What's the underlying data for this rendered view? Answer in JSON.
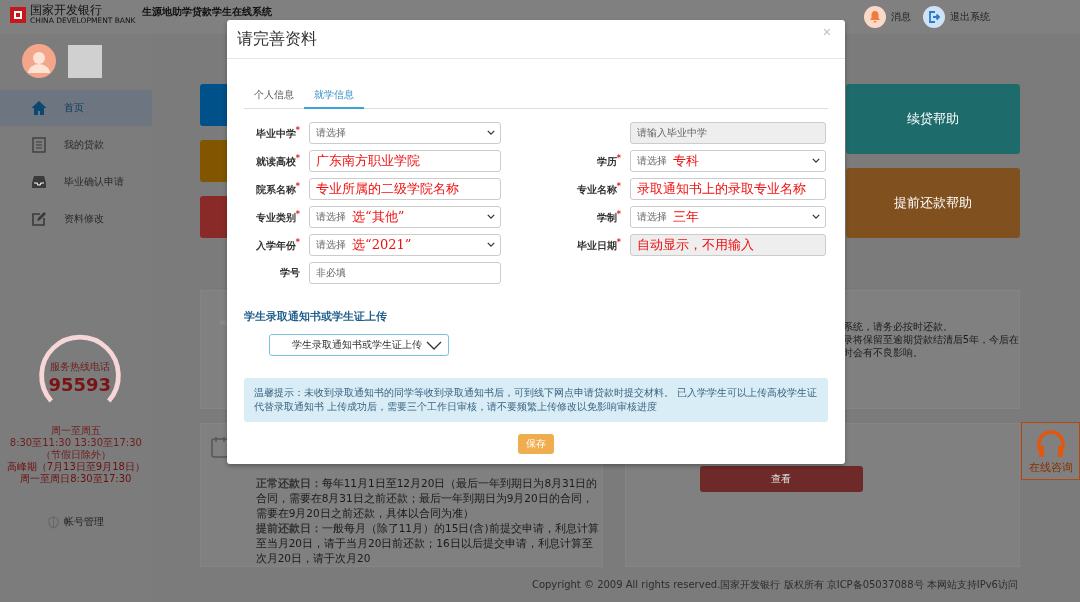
{
  "header": {
    "bank_name": "国家开发银行",
    "bank_name_en": "CHINA DEVELOPMENT BANK",
    "system_title": "生源地助学贷款学生在线系统",
    "actions": [
      {
        "label": "消息"
      },
      {
        "label": "退出系统"
      }
    ]
  },
  "sidebar": {
    "items": [
      {
        "label": "首页",
        "selected": true
      },
      {
        "label": "我的贷款",
        "selected": false
      },
      {
        "label": "毕业确认申请",
        "selected": false
      },
      {
        "label": "资料修改",
        "selected": false
      }
    ],
    "hotline": {
      "title": "服务热线电话",
      "number": "95593",
      "hours": [
        "周一至周五",
        "8:30至11:30 13:30至17:30",
        "（节假日除外）"
      ],
      "peak_hours": [
        "高峰期（7月13日至9月18日）",
        "周一至周日8:30至17:30"
      ]
    },
    "account_link": "帐号管理"
  },
  "tiles_left": [
    {
      "color": "#00508a"
    },
    {
      "color": "#825600"
    },
    {
      "color": "#8a2a28"
    }
  ],
  "tiles_right": [
    {
      "label": "续贷帮助",
      "color": "#1d6b6b"
    },
    {
      "label": "提前还款帮助",
      "color": "#80501e"
    }
  ],
  "notice": {
    "lines": [
      "系统，请务必按时还款。",
      "录将保留至逾期贷款结清后5年，今后在",
      "时会有不良影响。"
    ]
  },
  "repayment": {
    "paragraphs": [
      "**正常还款日：**每年11月1日至12月20日（最后一年到期日为8月31日的合同，需要在8月31日之前还款；最后一年到期日为9月20日的合同，需要在9月20日之前还款，具体以合同为准）",
      "**提前还款日：**一般每月（除了11月）的15日(含)前提交申请，利息计算至当月20日，请于当月20日前还款；16日以后提交申请，利息计算至次月20日，请于次月20"
    ]
  },
  "view_button": "查看",
  "footer": "Copyright © 2009 All rights reserved.国家开发银行 版权所有 京ICP备05037088号 本网站支持IPv6访问",
  "consult": "在线咨询",
  "dialog": {
    "title": "请完善资料",
    "close": "×",
    "tabs": [
      {
        "label": "个人信息",
        "selected": false
      },
      {
        "label": "就学信息",
        "selected": true
      }
    ],
    "rows": [
      {
        "left": {
          "label": "毕业中学$^{*}$",
          "kind": "select",
          "placeholder": "请选择",
          "disabled": false
        },
        "right": {
          "kind": "input",
          "placeholder": "请输入毕业中学",
          "disabled": true
        }
      },
      {
        "left": {
          "label": "就读高校$^{*}$",
          "kind": "input",
          "note": "广东南方职业学院",
          "disabled": false
        },
        "right": {
          "label": "学历$^{*}$",
          "kind": "select",
          "placeholder": "请选择",
          "note": "专科",
          "disabled": false
        }
      },
      {
        "left": {
          "label": "院系名称$^{*}$",
          "kind": "input",
          "note": "专业所属的二级学院名称",
          "disabled": false
        },
        "right": {
          "label": "专业名称$^{*}$",
          "kind": "input",
          "note": "录取通知书上的录取专业名称",
          "disabled": false
        }
      },
      {
        "left": {
          "label": "专业类别$^{*}$",
          "kind": "select",
          "placeholder": "请选择",
          "note": "选“其他”",
          "disabled": false
        },
        "right": {
          "label": "学制$^{*}$",
          "kind": "select",
          "placeholder": "请选择",
          "note": "三年",
          "disabled": false
        }
      },
      {
        "left": {
          "label": "入学年份$^{*}$",
          "kind": "select",
          "placeholder": "请选择",
          "note": "选“2021”",
          "disabled": false
        },
        "right": {
          "label": "毕业日期$^{*}$",
          "kind": "input",
          "note": "自动显示，不用输入",
          "disabled": true
        }
      },
      {
        "left": {
          "label": "学号",
          "kind": "input",
          "placeholder": "非必填",
          "disabled": false
        }
      }
    ],
    "upload": {
      "title": "学生录取通知书或学生证上传",
      "button": "学生录取通知书或学生证上传"
    },
    "tip": "温馨提示：未收到录取通知书的同学等收到录取通知书后，可到线下网点申请贷款时提交材料。 已入学学生可以上传高校学生证代替录取通知书 上传成功后，需要三个工作日审核，请不要频繁上传修改以免影响审核进度",
    "save": "保存"
  }
}
